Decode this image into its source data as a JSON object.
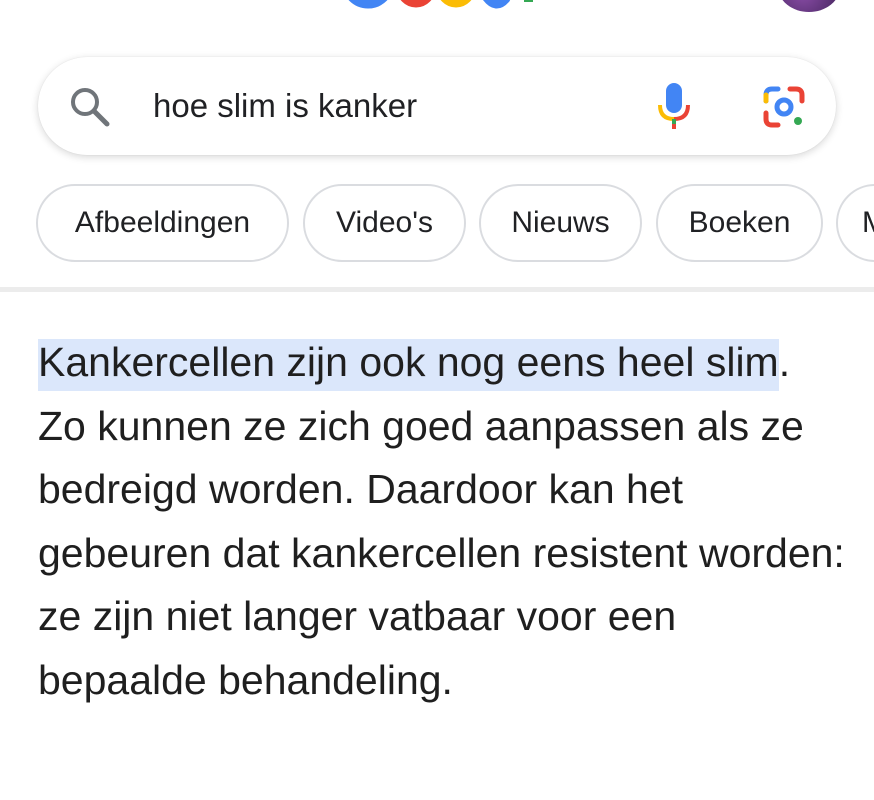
{
  "search": {
    "query": "hoe slim is kanker"
  },
  "chips": [
    {
      "label": "Afbeeldingen"
    },
    {
      "label": "Video's"
    },
    {
      "label": "Nieuws"
    },
    {
      "label": "Boeken"
    },
    {
      "label": "M"
    }
  ],
  "answer": {
    "highlighted_text": "Kankercellen zijn ook nog eens heel slim",
    "rest_text": ". Zo kunnen ze zich goed aanpassen als ze bedreigd worden. Daardoor kan het gebeuren dat kankercellen resistent worden: ze zijn niet langer vatbaar voor een bepaalde behandeling."
  },
  "colors": {
    "google_blue": "#4285F4",
    "google_red": "#EA4335",
    "google_yellow": "#FBBC05",
    "google_green": "#34A853",
    "highlight": "#dbe7fb",
    "chip_border": "#dadce0"
  },
  "icons": {
    "search": "search-icon",
    "voice": "microphone-icon",
    "lens": "google-lens-icon"
  }
}
